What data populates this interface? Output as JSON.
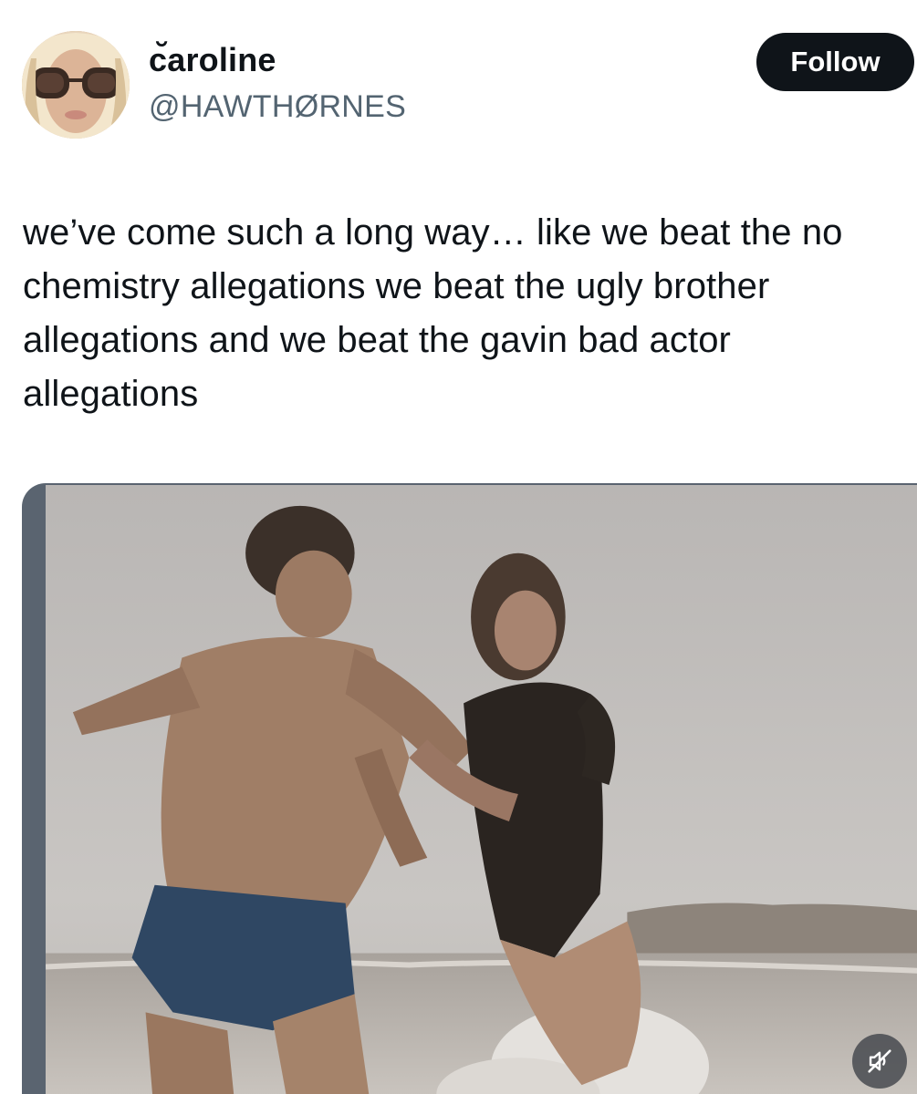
{
  "author": {
    "display_name": "c̆aroline",
    "handle": "@HAWTHØRNES",
    "avatar_icon": "profile-photo"
  },
  "actions": {
    "follow_label": "Follow"
  },
  "post": {
    "text": "we’ve come such a long way… like we beat the no chemistry allegations we beat the ugly brother allegations and we beat the gavin bad actor allegations"
  },
  "media": {
    "type": "video",
    "mute_icon": "volume-muted-icon"
  },
  "colors": {
    "text_primary": "#0f1419",
    "text_secondary": "#536471",
    "follow_bg": "#0f1419",
    "follow_text": "#ffffff"
  }
}
